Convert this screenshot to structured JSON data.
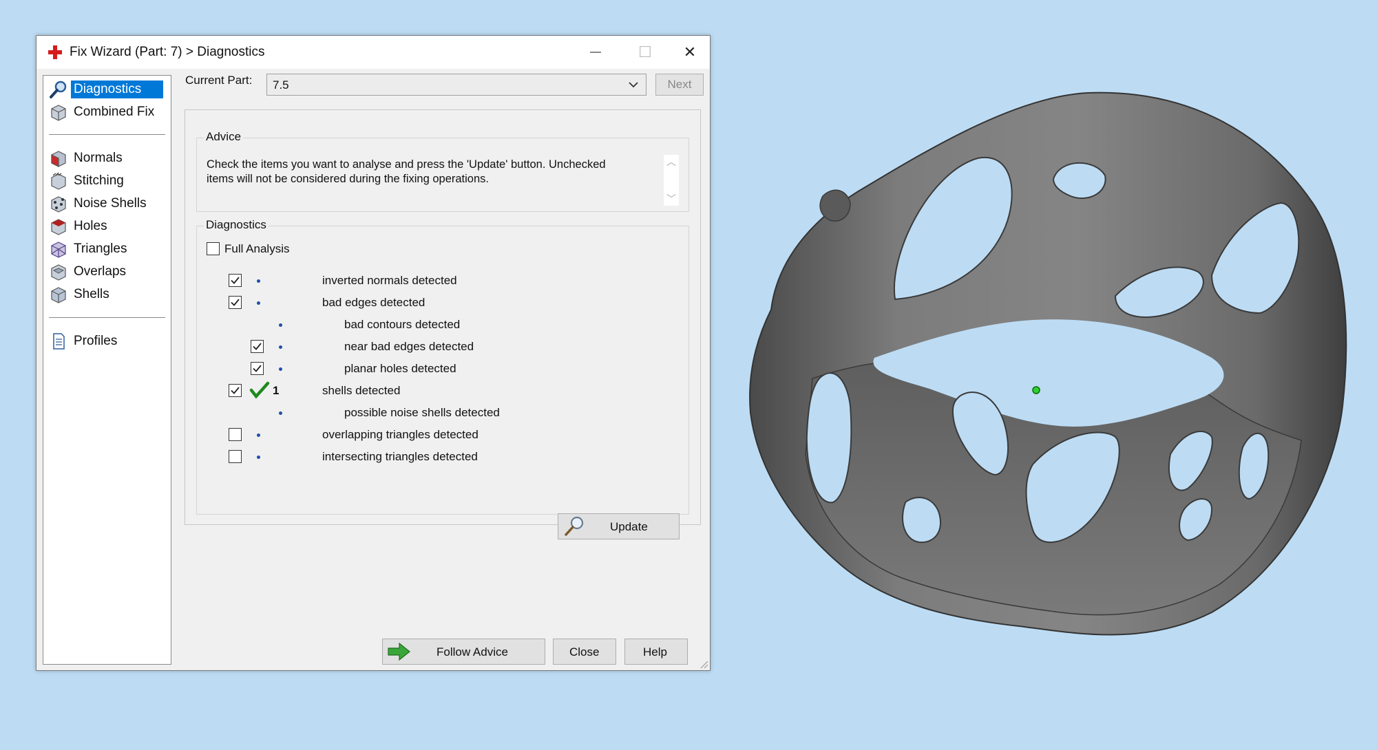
{
  "window": {
    "title": "Fix Wizard (Part: 7) > Diagnostics",
    "minimize_glyph": "—",
    "maximize_glyph": "☐",
    "close_glyph": "✕"
  },
  "sidebar": {
    "items": [
      {
        "label": "Diagnostics",
        "icon": "magnifier-icon",
        "selected": true
      },
      {
        "label": "Combined Fix",
        "icon": "cube-icon"
      },
      {
        "label": "Normals",
        "icon": "cube-red-face-icon"
      },
      {
        "label": "Stitching",
        "icon": "cube-stitch-icon"
      },
      {
        "label": "Noise Shells",
        "icon": "cube-dots-icon"
      },
      {
        "label": "Holes",
        "icon": "cube-hole-icon"
      },
      {
        "label": "Triangles",
        "icon": "cube-triangles-icon"
      },
      {
        "label": "Overlaps",
        "icon": "cube-overlap-icon"
      },
      {
        "label": "Shells",
        "icon": "cube-shells-icon"
      },
      {
        "label": "Profiles",
        "icon": "document-icon"
      }
    ]
  },
  "part": {
    "label": "Current Part:",
    "value": "7.5",
    "next_label": "Next"
  },
  "advice": {
    "title": "Advice",
    "text_line1": "Check the items you want to analyse and press the 'Update' button. Unchecked",
    "text_line2": "items will not be considered during the fixing operations."
  },
  "diagnostics": {
    "title": "Diagnostics",
    "full_analysis_label": "Full Analysis",
    "full_analysis_checked": false,
    "rows": [
      {
        "label": "inverted normals detected",
        "checked": true,
        "count": ""
      },
      {
        "label": "bad edges detected",
        "checked": true,
        "count": ""
      },
      {
        "label": "bad contours detected",
        "checked": null,
        "count": ""
      },
      {
        "label": "near bad edges detected",
        "checked": true,
        "count": ""
      },
      {
        "label": "planar holes detected",
        "checked": true,
        "count": ""
      },
      {
        "label": "shells detected",
        "checked": true,
        "count": "1",
        "status": "ok-checkmark-icon"
      },
      {
        "label": "possible noise shells detected",
        "checked": null,
        "count": ""
      },
      {
        "label": "overlapping triangles detected",
        "checked": false,
        "count": ""
      },
      {
        "label": "intersecting triangles detected",
        "checked": false,
        "count": ""
      }
    ],
    "update_label": "Update"
  },
  "footer": {
    "follow_advice_label": "Follow Advice",
    "close_label": "Close",
    "help_label": "Help"
  },
  "colors": {
    "desktop_bg": "#bddcf4",
    "selection": "#0078d7",
    "model_gray": "#6e6e6e",
    "ok_green": "#1e8a1e"
  }
}
